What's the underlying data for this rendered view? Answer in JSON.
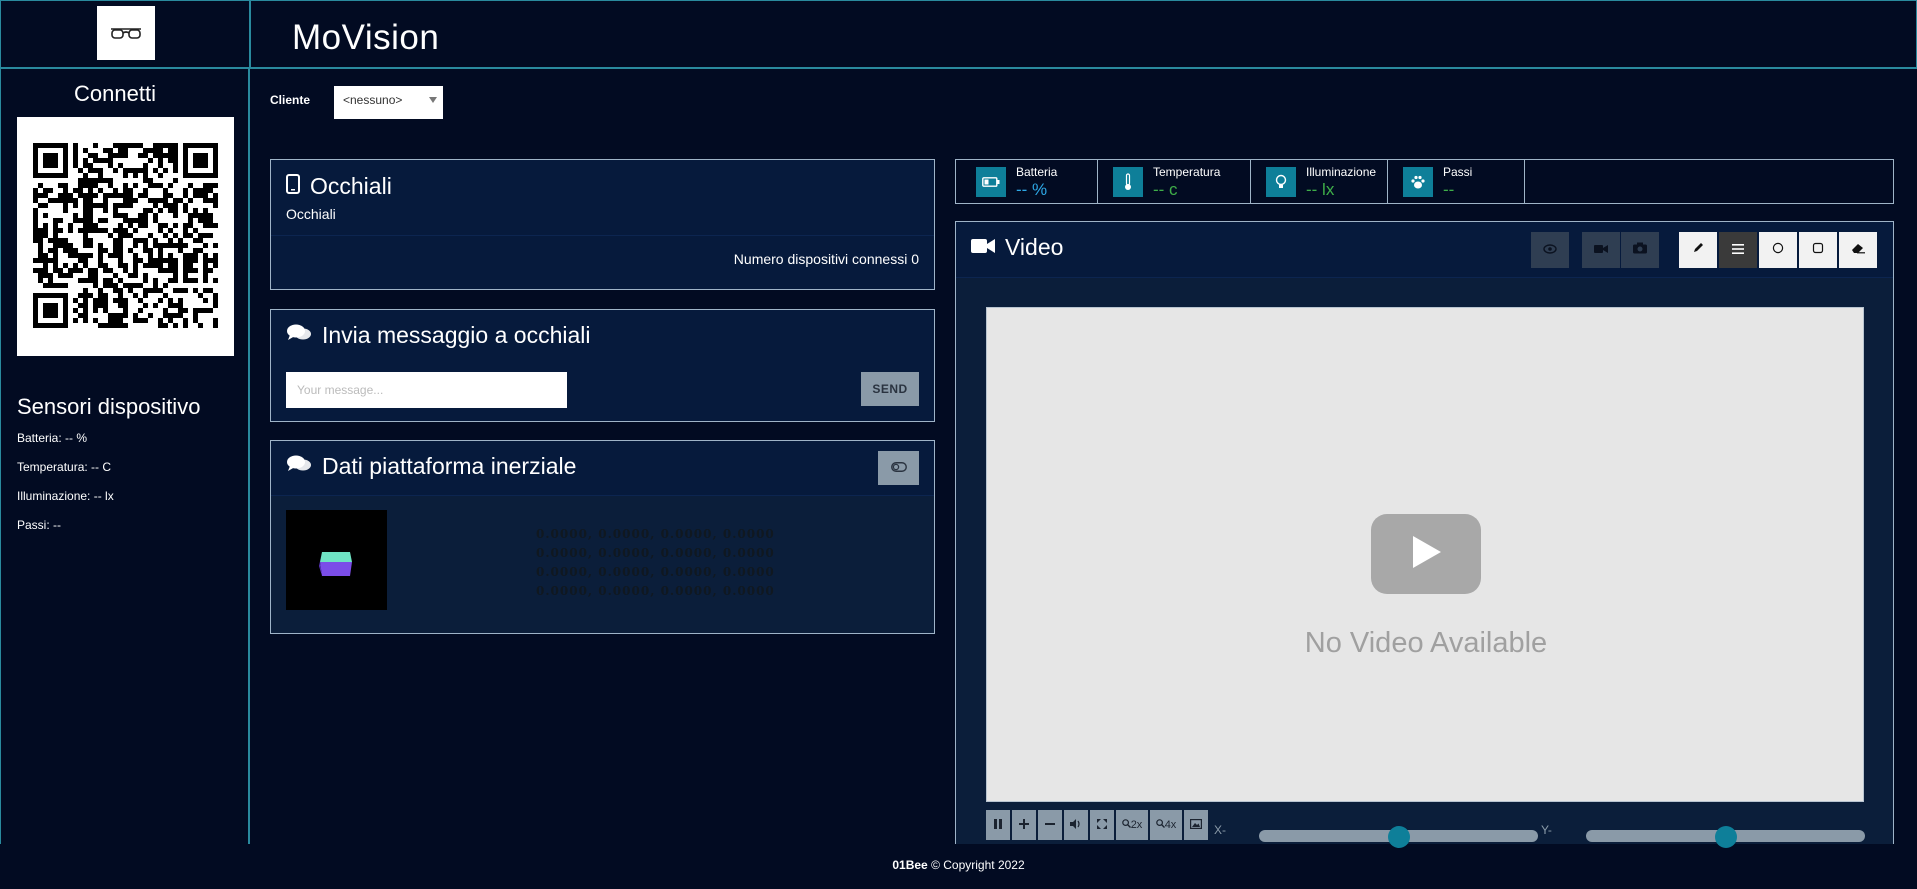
{
  "app": {
    "title": "MoVision"
  },
  "sidebar": {
    "connect_title": "Connetti",
    "sensors_title": "Sensori dispositivo",
    "sensors": [
      {
        "label": "Batteria: -- %"
      },
      {
        "label": "Temperatura: -- C"
      },
      {
        "label": "Illuminazione: -- lx"
      },
      {
        "label": "Passi: --"
      }
    ]
  },
  "client": {
    "label": "Cliente",
    "selected": "<nessuno>"
  },
  "glasses_panel": {
    "title": "Occhiali",
    "subtitle": "Occhiali",
    "connected_devices": "Numero dispositivi connessi 0"
  },
  "message_panel": {
    "title": "Invia messaggio a occhiali",
    "placeholder": "Your message...",
    "send_label": "SEND"
  },
  "imu_panel": {
    "title": "Dati piattaforma inerziale",
    "matrix": [
      "0.0000, 0.0000, 0.0000, 0.0000",
      "0.0000, 0.0000, 0.0000, 0.0000",
      "0.0000, 0.0000, 0.0000, 0.0000",
      "0.0000, 0.0000, 0.0000, 0.0000"
    ]
  },
  "sensor_strip": [
    {
      "label": "Batteria",
      "value": "-- %",
      "icon": "battery-icon",
      "color": "#2ea8e6"
    },
    {
      "label": "Temperatura",
      "value": "-- c",
      "icon": "thermometer-icon",
      "color": "#3fae49"
    },
    {
      "label": "Illuminazione",
      "value": "-- lx",
      "icon": "lightbulb-icon",
      "color": "#3fae49"
    },
    {
      "label": "Passi",
      "value": "--",
      "icon": "paw-icon",
      "color": "#3fae49"
    }
  ],
  "video_panel": {
    "title": "Video",
    "no_video": "No Video Available",
    "zoom_2x": "2x",
    "zoom_4x": "4x",
    "x_offset_label": "X-Offset",
    "y_offset_label": "Y-Offset",
    "x_offset": 0.5,
    "y_offset": 0.5
  },
  "footer": {
    "brand": "01Bee",
    "copyright": "© Copyright 2022"
  },
  "colors": {
    "accent": "#2a8a9e",
    "background": "#020b22",
    "panel": "#061a3c",
    "icon_teal": "#0e7f99"
  }
}
